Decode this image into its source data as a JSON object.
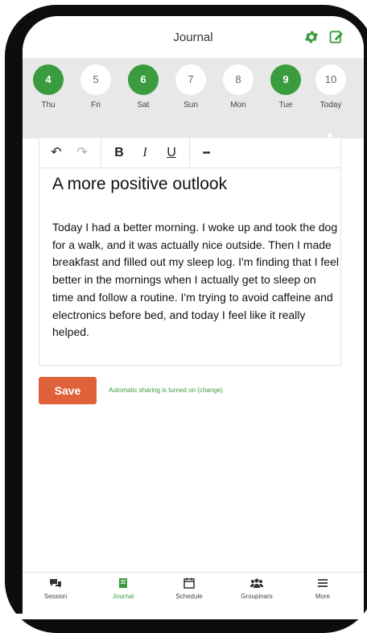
{
  "header": {
    "title": "Journal",
    "icons": [
      "gear-icon",
      "edit-icon"
    ]
  },
  "days": [
    {
      "number": "4",
      "label": "Thu",
      "done": true
    },
    {
      "number": "5",
      "label": "Fri",
      "done": false
    },
    {
      "number": "6",
      "label": "Sat",
      "done": true
    },
    {
      "number": "7",
      "label": "Sun",
      "done": false
    },
    {
      "number": "8",
      "label": "Mon",
      "done": false
    },
    {
      "number": "9",
      "label": "Tue",
      "done": true
    },
    {
      "number": "10",
      "label": "Today",
      "done": false
    }
  ],
  "toolbar": {
    "undo": "↶",
    "redo": "↷",
    "bold": "B",
    "italic": "I",
    "underline": "U",
    "more": "•••"
  },
  "entry": {
    "title": "A more positive outlook",
    "body": "Today I had a better morning. I woke up and took the dog for a walk, and it was actually nice outside. Then I made breakfast and filled out my sleep log. I'm finding that I feel better in the mornings when I actually get to sleep on time and follow a routine. I'm trying to avoid caffeine and electronics before bed, and today I feel like it really helped."
  },
  "save_label": "Save",
  "sharing": {
    "text": "Automatic sharing is turned on",
    "change_label": "(change)"
  },
  "nav": [
    {
      "label": "Session",
      "icon": "chat-icon",
      "active": false
    },
    {
      "label": "Journal",
      "icon": "notebook-icon",
      "active": true
    },
    {
      "label": "Schedule",
      "icon": "calendar-icon",
      "active": false
    },
    {
      "label": "Groupinars",
      "icon": "group-icon",
      "active": false
    },
    {
      "label": "More",
      "icon": "menu-icon",
      "active": false
    }
  ],
  "colors": {
    "accent_green": "#3a9c3f",
    "save_orange": "#e0623a",
    "strip_gray": "#e8e8e8"
  }
}
